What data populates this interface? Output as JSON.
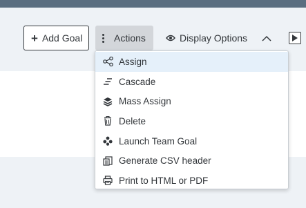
{
  "toolbar": {
    "add_goal_label": "Add Goal",
    "actions_label": "Actions",
    "display_options_label": "Display Options"
  },
  "menu": {
    "items": [
      {
        "label": "Assign",
        "icon": "share-nodes-icon",
        "selected": true
      },
      {
        "label": "Cascade",
        "icon": "cascade-lines-icon",
        "selected": false
      },
      {
        "label": "Mass Assign",
        "icon": "layers-icon",
        "selected": false
      },
      {
        "label": "Delete",
        "icon": "trash-icon",
        "selected": false
      },
      {
        "label": "Launch Team Goal",
        "icon": "team-icon",
        "selected": false
      },
      {
        "label": "Generate CSV header",
        "icon": "csv-document-icon",
        "selected": false
      },
      {
        "label": "Print to HTML or PDF",
        "icon": "printer-icon",
        "selected": false
      }
    ]
  },
  "colors": {
    "header_bar": "#5a6e80",
    "toolbar_background": "#eef2f6",
    "actions_button_active": "#d3d6da",
    "menu_selected": "#e5f0fa",
    "icon_color": "#32363a"
  }
}
